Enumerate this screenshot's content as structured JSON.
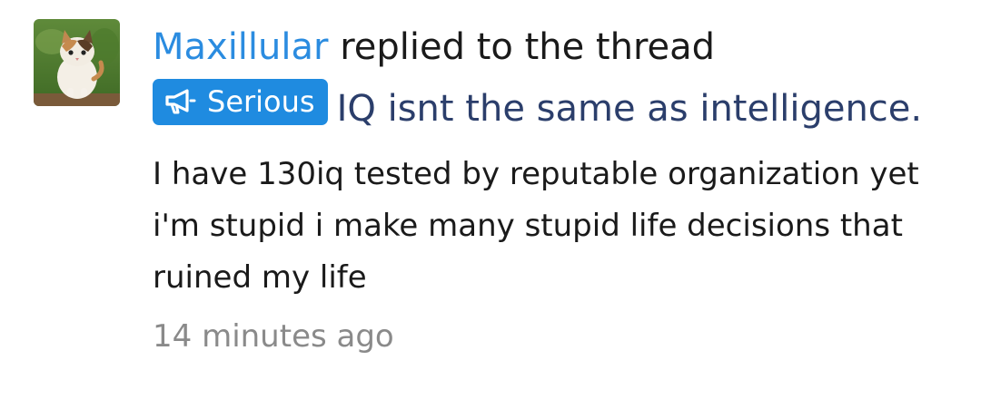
{
  "alert": {
    "username": "Maxillular",
    "action": "replied to the thread",
    "prefix": {
      "label": "Serious",
      "icon": "megaphone-icon",
      "color": "#1f8be0"
    },
    "thread_title": "IQ isnt the same as intelligence.",
    "snippet": "I have 130iq tested by reputable organization yet i'm stupid i make many stupid life decisions that ruined my life",
    "time": "14 minutes ago"
  },
  "colors": {
    "username": "#2b8ce0",
    "thread_title": "#2b3e6b",
    "body_text": "#1a1a1a",
    "timestamp": "#8a8a8a"
  }
}
